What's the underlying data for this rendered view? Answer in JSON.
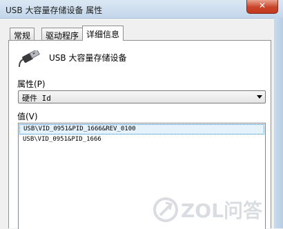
{
  "window": {
    "title": "USB 大容量存储设备 属性",
    "close_glyph": "✕"
  },
  "tabs": [
    {
      "label": "常规",
      "active": false
    },
    {
      "label": "驱动程序",
      "active": false
    },
    {
      "label": "详细信息",
      "active": true
    }
  ],
  "device": {
    "icon": "usb-plug-icon",
    "name": "USB 大容量存储设备"
  },
  "property": {
    "label": "属性(P)",
    "selected": "硬件 Id"
  },
  "values": {
    "label": "值(V)",
    "items": [
      {
        "text": "USB\\VID_0951&PID_1666&REV_0100",
        "selected": true
      },
      {
        "text": "USB\\VID_0951&PID_1666",
        "selected": false
      }
    ]
  },
  "watermark": {
    "text": "ZOL问答"
  },
  "colors": {
    "titlebar": "#c9dbee",
    "close": "#c9452a",
    "selection": "#e5f1fb"
  }
}
